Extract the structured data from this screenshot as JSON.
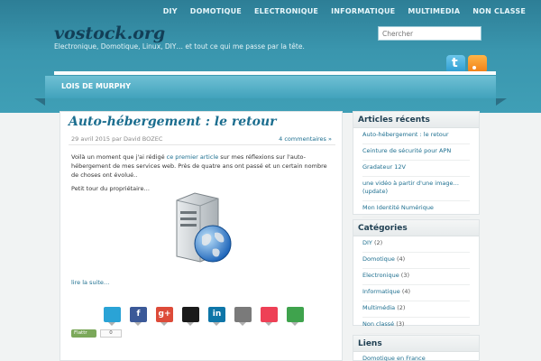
{
  "nav": [
    "DIY",
    "DOMOTIQUE",
    "ELECTRONIQUE",
    "INFORMATIQUE",
    "MULTIMEDIA",
    "NON CLASSE"
  ],
  "site": {
    "title": "vostock.org",
    "description": "Electronique, Domotique, Linux, DIY… et tout ce qui me passe par la tête."
  },
  "search": {
    "placeholder": "Chercher"
  },
  "social": {
    "icons": [
      "twitter-icon",
      "rss-icon"
    ]
  },
  "menu": {
    "item": "LOIS DE MURPHY"
  },
  "post": {
    "title": "Auto-hébergement : le retour",
    "meta": "29 avril 2015 par David BOZEC",
    "comments": "4 commentaires »",
    "intro_before": "Voilà un moment que j'ai rédigé ",
    "intro_link": "ce premier article",
    "intro_after": " sur mes réflexions sur l'auto-hébergement de mes services web. Près de quatre ans ont passé et un certain nombre de choses ont évolué..",
    "tour": "Petit tour du propriétaire…",
    "read_more": "lire la suite…",
    "share_icons": [
      "twitter-icon",
      "facebook-icon",
      "google-plus-icon",
      "delicious-icon",
      "linkedin-icon",
      "email-icon",
      "pocket-icon",
      "share-icon"
    ],
    "share_colors": [
      "#2aa3d6",
      "#3b5998",
      "#dd4b39",
      "#1a1a1a",
      "#0e76a8",
      "#7a7a7a",
      "#ee4056",
      "#3fa34d"
    ],
    "share_glyphs": [
      "",
      "f",
      "g+",
      "",
      "in",
      "",
      "",
      ""
    ],
    "flattr_label": "Flattr",
    "flattr_count": "0"
  },
  "sidebar": {
    "recent": {
      "title": "Articles récents",
      "items": [
        "Auto-hébergement : le retour",
        "Ceinture de sécurité pour APN",
        "Gradateur 12V",
        "une vidéo à partir d'une image… (update)",
        "Mon Identité Numérique"
      ]
    },
    "categories": {
      "title": "Catégories",
      "items": [
        {
          "name": "DIY",
          "count": "(2)"
        },
        {
          "name": "Domotique",
          "count": "(4)"
        },
        {
          "name": "Electronique",
          "count": "(3)"
        },
        {
          "name": "Informatique",
          "count": "(4)"
        },
        {
          "name": "Multimédia",
          "count": "(2)"
        },
        {
          "name": "Non classé",
          "count": "(3)"
        }
      ]
    },
    "links": {
      "title": "Liens",
      "items": [
        "Domotique en France"
      ]
    }
  }
}
